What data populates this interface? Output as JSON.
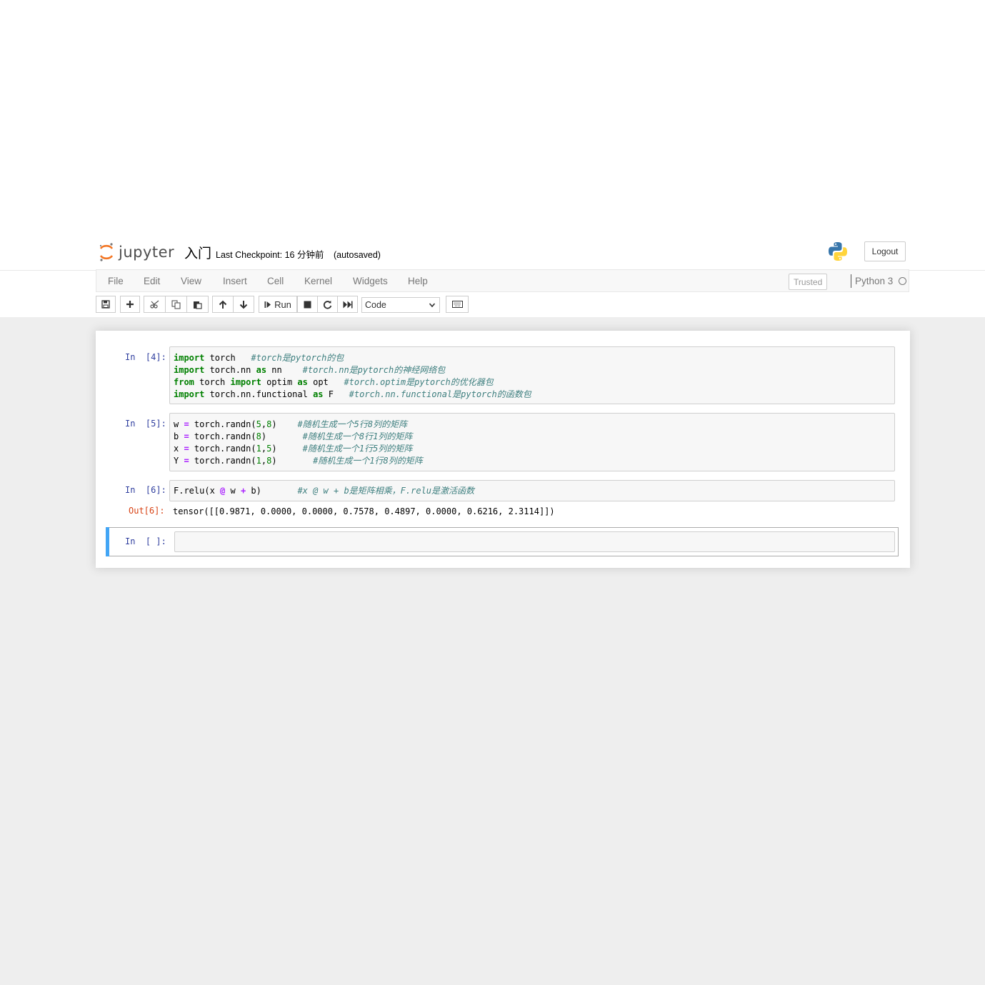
{
  "header": {
    "logo_text": "jupyter",
    "notebook_name": "入门",
    "checkpoint_label": "Last Checkpoint: 16 分钟前",
    "autosave_label": "(autosaved)",
    "logout_label": "Logout"
  },
  "menu": {
    "items": [
      "File",
      "Edit",
      "View",
      "Insert",
      "Cell",
      "Kernel",
      "Widgets",
      "Help"
    ],
    "trusted_label": "Trusted",
    "kernel_name": "Python 3"
  },
  "toolbar": {
    "run_label": "Run",
    "cell_type": "Code",
    "icons": [
      "save-icon",
      "plus-icon",
      "cut-icon",
      "copy-icon",
      "paste-icon",
      "arrow-up-icon",
      "arrow-down-icon",
      "run-icon",
      "stop-icon",
      "restart-icon",
      "fast-forward-icon",
      "keyboard-icon"
    ]
  },
  "cells": [
    {
      "prompt": "In  [4]:",
      "lines": [
        {
          "code": "import torch",
          "comment": "#torch是pytorch的包"
        },
        {
          "code": "import torch.nn as nn",
          "comment": "#torch.nn是pytorch的神经网络包"
        },
        {
          "code": "from torch import optim as opt",
          "comment": "#torch.optim是pytorch的优化器包"
        },
        {
          "code": "import torch.nn.functional as F",
          "comment": "#torch.nn.functional是pytorch的函数包"
        }
      ]
    },
    {
      "prompt": "In  [5]:",
      "lines": [
        {
          "code": "w = torch.randn(5,8)",
          "comment": "#随机生成一个5行8列的矩阵"
        },
        {
          "code": "b = torch.randn(8)",
          "comment": "#随机生成一个8行1列的矩阵"
        },
        {
          "code": "x = torch.randn(1,5)",
          "comment": "#随机生成一个1行5列的矩阵"
        },
        {
          "code": "Y = torch.randn(1,8)",
          "comment": "#随机生成一个1行8列的矩阵"
        }
      ]
    },
    {
      "prompt": "In  [6]:",
      "lines": [
        {
          "code": "F.relu(x @ w + b)",
          "comment": "#x @ w + b是矩阵相乘，F.relu是激活函数"
        }
      ],
      "out_prompt": "Out[6]:",
      "output": "tensor([[0.9871, 0.0000, 0.0000, 0.7578, 0.4897, 0.0000, 0.6216, 2.3114]])"
    },
    {
      "prompt": "In  [ ]:"
    }
  ]
}
